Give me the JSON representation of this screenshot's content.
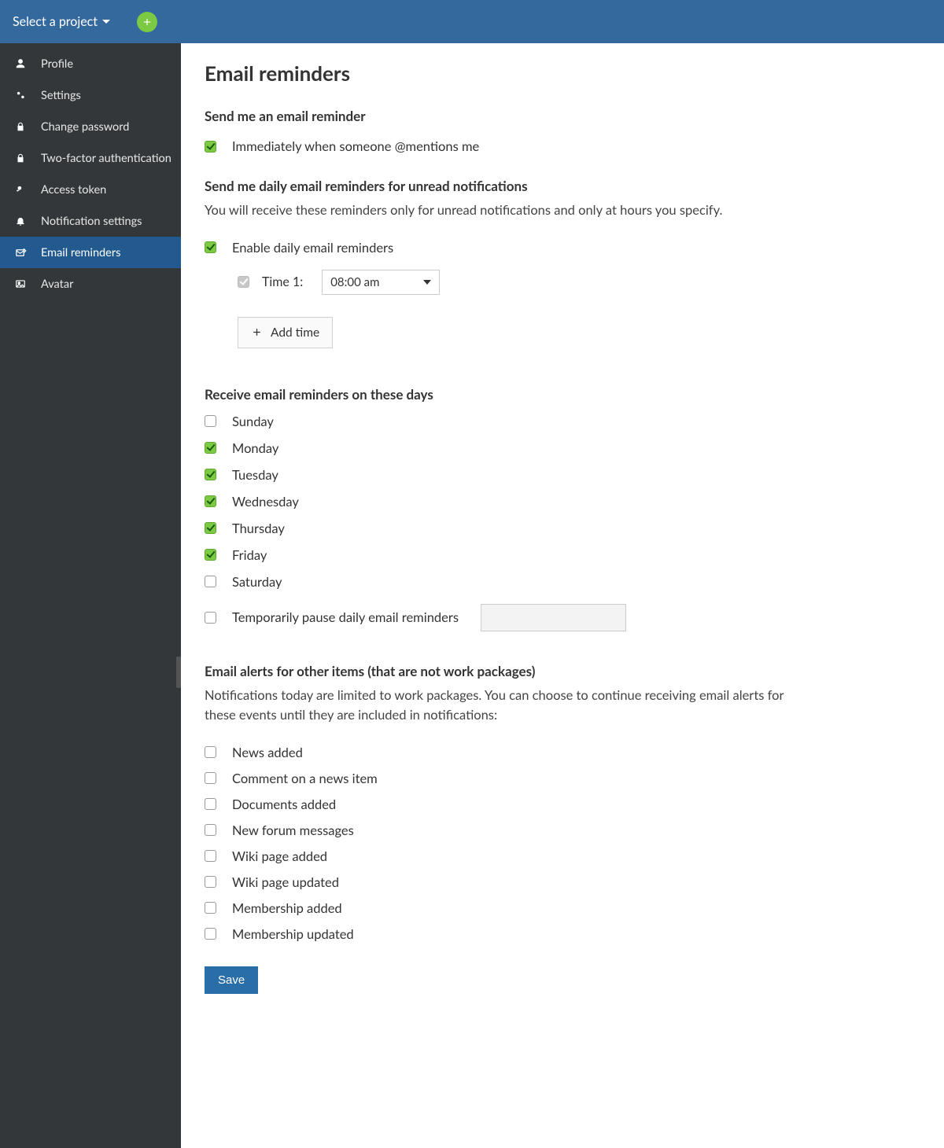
{
  "header": {
    "project_selector": "Select a project"
  },
  "sidebar": {
    "items": [
      {
        "label": "Profile"
      },
      {
        "label": "Settings"
      },
      {
        "label": "Change password"
      },
      {
        "label": "Two-factor authentication"
      },
      {
        "label": "Access token"
      },
      {
        "label": "Notification settings"
      },
      {
        "label": "Email reminders"
      },
      {
        "label": "Avatar"
      }
    ]
  },
  "page": {
    "title": "Email reminders",
    "section1_heading": "Send me an email reminder",
    "mentions_label": "Immediately when someone @mentions me",
    "section2_heading": "Send me daily email reminders for unread notifications",
    "section2_sub": "You will receive these reminders only for unread notifications and only at hours you specify.",
    "enable_daily_label": "Enable daily email reminders",
    "time1_label": "Time 1:",
    "time1_value": "08:00 am",
    "add_time_label": "Add time",
    "days_heading": "Receive email reminders on these days",
    "days": [
      {
        "label": "Sunday",
        "checked": false
      },
      {
        "label": "Monday",
        "checked": true
      },
      {
        "label": "Tuesday",
        "checked": true
      },
      {
        "label": "Wednesday",
        "checked": true
      },
      {
        "label": "Thursday",
        "checked": true
      },
      {
        "label": "Friday",
        "checked": true
      },
      {
        "label": "Saturday",
        "checked": false
      }
    ],
    "pause_label": "Temporarily pause daily email reminders",
    "alerts_heading": "Email alerts for other items (that are not work packages)",
    "alerts_sub": "Notifications today are limited to work packages. You can choose to continue receiving email alerts for these events until they are included in notifications:",
    "alerts": [
      {
        "label": "News added"
      },
      {
        "label": "Comment on a news item"
      },
      {
        "label": "Documents added"
      },
      {
        "label": "New forum messages"
      },
      {
        "label": "Wiki page added"
      },
      {
        "label": "Wiki page updated"
      },
      {
        "label": "Membership added"
      },
      {
        "label": "Membership updated"
      }
    ],
    "save_label": "Save"
  }
}
